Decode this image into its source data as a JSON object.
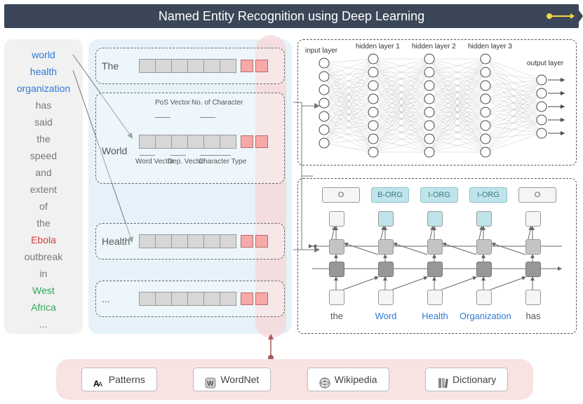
{
  "title": "Named Entity Recognition using Deep Learning",
  "words": [
    {
      "t": "world",
      "c": "blue"
    },
    {
      "t": "health",
      "c": "blue"
    },
    {
      "t": "organization",
      "c": "blue"
    },
    {
      "t": "has",
      "c": ""
    },
    {
      "t": "said",
      "c": ""
    },
    {
      "t": "the",
      "c": ""
    },
    {
      "t": "speed",
      "c": ""
    },
    {
      "t": "and",
      "c": ""
    },
    {
      "t": "extent",
      "c": ""
    },
    {
      "t": "of",
      "c": ""
    },
    {
      "t": "the",
      "c": ""
    },
    {
      "t": "Ebola",
      "c": "red"
    },
    {
      "t": "outbreak",
      "c": ""
    },
    {
      "t": "in",
      "c": ""
    },
    {
      "t": "West",
      "c": "green"
    },
    {
      "t": "Africa",
      "c": "green"
    },
    {
      "t": "...",
      "c": ""
    }
  ],
  "feat_rows": [
    "The",
    "World",
    "Health",
    "..."
  ],
  "feat_ann": {
    "top1": "PoS\nVector",
    "top2": "No. of\nCharacter",
    "bot1": "Word\nVector",
    "bot2": "Dep.\nVector",
    "bot3": "Character\nType"
  },
  "nn_labels": {
    "input": "input layer",
    "h1": "hidden layer 1",
    "h2": "hidden layer 2",
    "h3": "hidden layer 3",
    "output": "output layer"
  },
  "tags": [
    "O",
    "B-ORG",
    "I-ORG",
    "I-ORG",
    "O"
  ],
  "seq_words": [
    "the",
    "Word",
    "Health",
    "Organization",
    "has"
  ],
  "resources": [
    "Patterns",
    "WordNet",
    "Wikipedia",
    "Dictionary"
  ]
}
